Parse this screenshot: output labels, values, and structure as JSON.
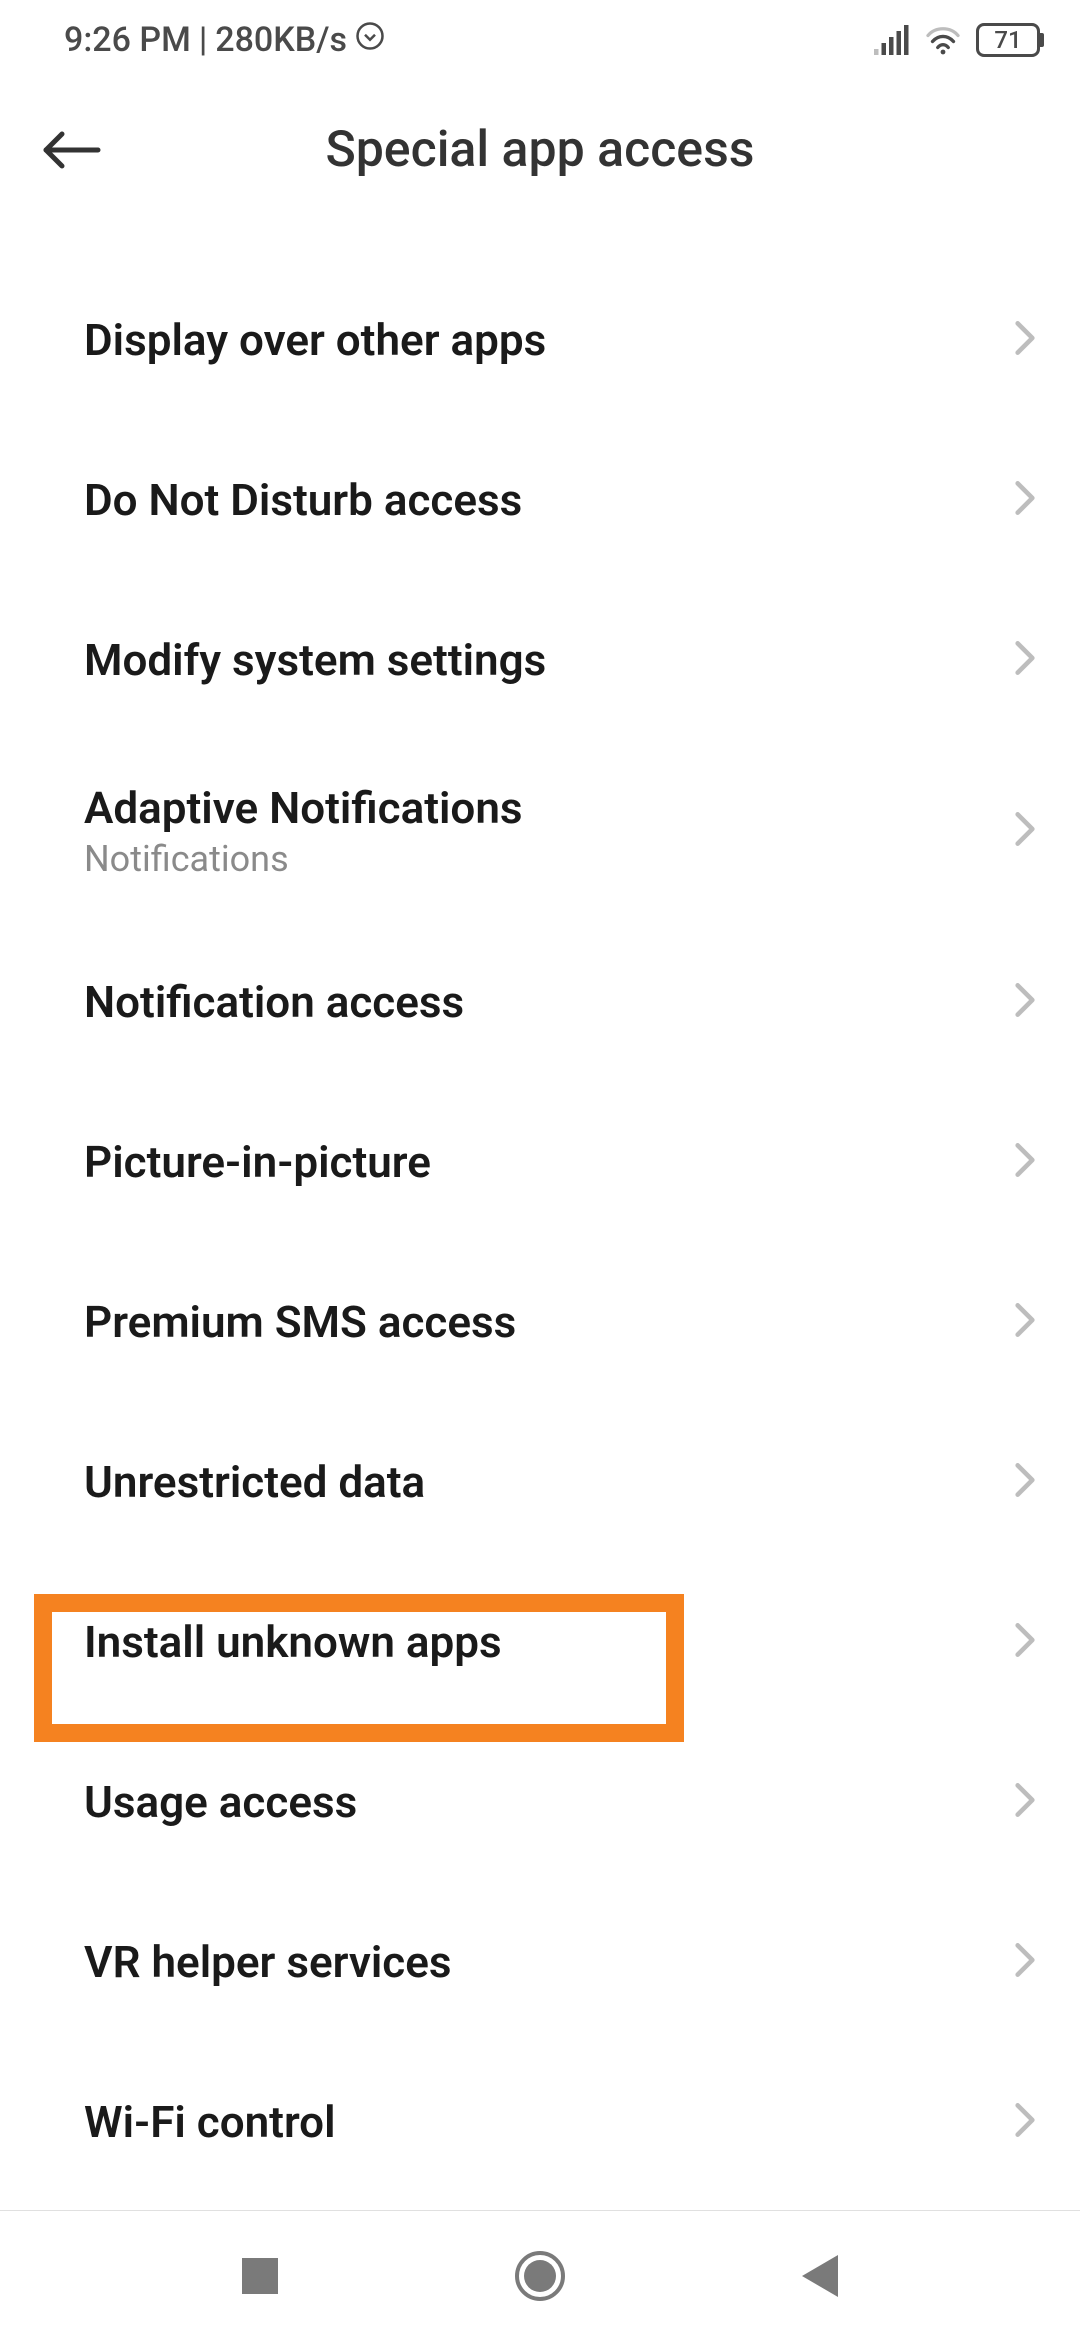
{
  "status": {
    "time": "9:26 PM",
    "speed": "280KB/s",
    "battery": "71"
  },
  "header": {
    "title": "Special app access"
  },
  "items": [
    {
      "label": "Display over other apps",
      "sub": null
    },
    {
      "label": "Do Not Disturb access",
      "sub": null
    },
    {
      "label": "Modify system settings",
      "sub": null
    },
    {
      "label": "Adaptive Notifications",
      "sub": "Notifications"
    },
    {
      "label": "Notification access",
      "sub": null
    },
    {
      "label": "Picture-in-picture",
      "sub": null
    },
    {
      "label": "Premium SMS access",
      "sub": null
    },
    {
      "label": "Unrestricted data",
      "sub": null
    },
    {
      "label": "Install unknown apps",
      "sub": null
    },
    {
      "label": "Usage access",
      "sub": null
    },
    {
      "label": "VR helper services",
      "sub": null
    },
    {
      "label": "Wi-Fi control",
      "sub": null
    }
  ],
  "highlighted_index": 8
}
